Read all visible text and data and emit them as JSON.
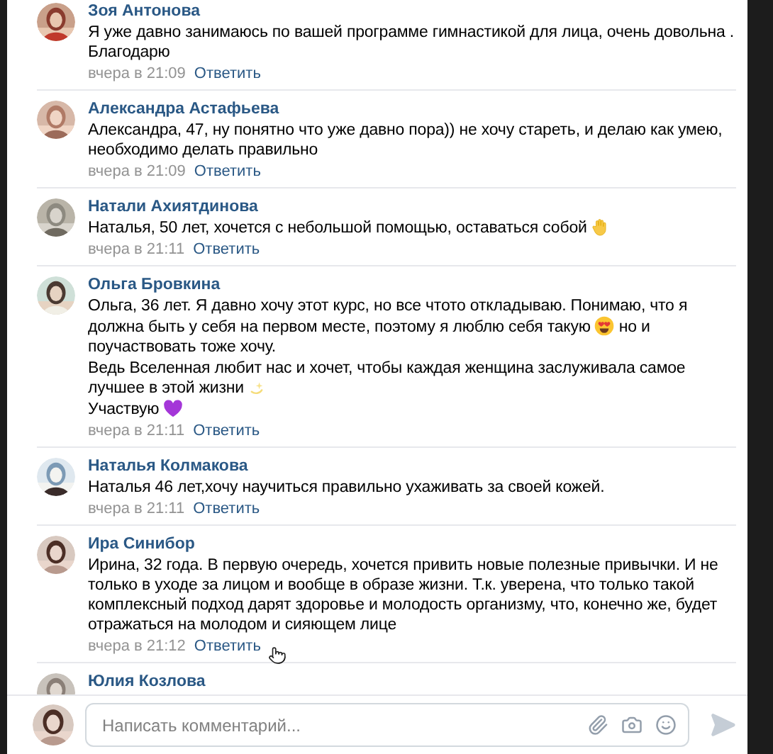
{
  "comments": [
    {
      "author": "Зоя Антонова",
      "paragraphs": [
        [
          {
            "kind": "text",
            "text": "Я уже давно занимаюсь по вашей программе гимнастикой для лица, очень довольна . Благодарю"
          }
        ]
      ],
      "time": "вчера в 21:09",
      "reply": "Ответить"
    },
    {
      "author": "Александра Астафьева",
      "paragraphs": [
        [
          {
            "kind": "text",
            "text": "Александра, 47, ну понятно что уже давно пора)) не хочу стареть, и делаю как умею, необходимо делать правильно"
          }
        ]
      ],
      "time": "вчера в 21:09",
      "reply": "Ответить"
    },
    {
      "author": "Натали Ахиятдинова",
      "paragraphs": [
        [
          {
            "kind": "text",
            "text": "Наталья, 50 лет, хочется с небольшой помощью, оставаться собой"
          },
          {
            "kind": "hand"
          }
        ]
      ],
      "time": "вчера в 21:11",
      "reply": "Ответить"
    },
    {
      "author": "Ольга Бровкина",
      "paragraphs": [
        [
          {
            "kind": "text",
            "text": "Ольга, 36 лет. Я давно хочу этот курс, но все чтото откладываю. Понимаю, что я должна быть у себя на первом месте, поэтому я люблю себя такую"
          },
          {
            "kind": "smiley"
          },
          {
            "kind": "text",
            "text": "но и поучаствовать тоже хочу."
          }
        ],
        [
          {
            "kind": "text",
            "text": "Ведь Вселенная любит нас и хочет, чтобы каждая женщина заслуживала самое лучшее в этой жизни"
          },
          {
            "kind": "sparkle"
          }
        ],
        [
          {
            "kind": "text",
            "text": "Участвую"
          },
          {
            "kind": "heart"
          }
        ]
      ],
      "time": "вчера в 21:11",
      "reply": "Ответить"
    },
    {
      "author": "Наталья Колмакова",
      "paragraphs": [
        [
          {
            "kind": "text",
            "text": "Наталья 46 лет,хочу научиться правильно ухаживать за своей кожей."
          }
        ]
      ],
      "time": "вчера в 21:11",
      "reply": "Ответить"
    },
    {
      "author": "Ира Синибор",
      "paragraphs": [
        [
          {
            "kind": "text",
            "text": "Ирина, 32 года. В первую очередь, хочется привить новые полезные привычки. И не только в уходе за лицом и вообще в образе жизни. Т.к. уверена, что только такой комплексный подход дарят здоровье и молодость организму, что, конечно же, будет отражаться на молодом и сияющем лице"
          }
        ]
      ],
      "time": "вчера в 21:12",
      "reply": "Ответить"
    },
    {
      "author": "Юлия Козлова"
    }
  ],
  "composer": {
    "placeholder": "Написать комментарий..."
  }
}
